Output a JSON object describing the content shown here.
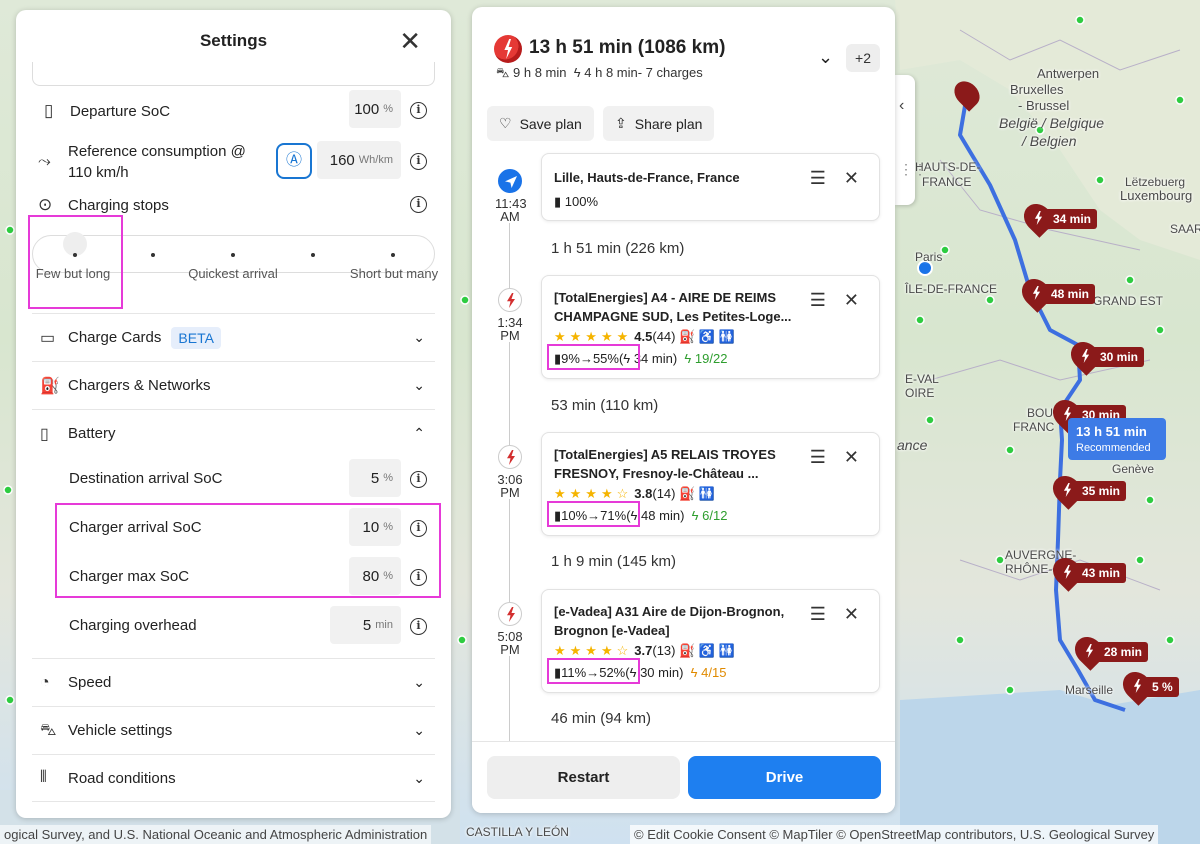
{
  "map": {
    "labels": {
      "antwerpen": "Antwerpen",
      "bruxelles": "Bruxelles",
      "brussel": "- Brussel",
      "belgie": "België / Belgique",
      "belgien": "/ Belgien",
      "letzebuerg": "Lëtzebuerg",
      "luxembourg": "Luxembourg",
      "hauts": "HAUTS-DE-",
      "france": "FRANCE",
      "paris": "Paris",
      "ile": "ÎLE-DE-FRANCE",
      "grand_est": "GRAND EST",
      "saarland": "SAARLA",
      "val": "E-VAL",
      "loire": "OIRE",
      "bour": "BOUR",
      "franc": "FRANC",
      "ance": "ance",
      "geneve": "Genève",
      "auvergne": "AUVERGNE-",
      "rhone": "RHÔNE-",
      "marseille": "Marseille",
      "castilla": "CASTILLA Y LEÓN"
    },
    "attribution_left": "ogical Survey, and U.S. National Oceanic and Atmospheric Administration",
    "attribution_right": "© Edit Cookie Consent  © MapTiler  © OpenStreetMap contributors, U.S. Geological Survey",
    "pins": [
      "34 min",
      "48 min",
      "30 min",
      "30 min",
      "35 min",
      "43 min",
      "28 min",
      "5 %"
    ],
    "route_label": {
      "time": "13 h 51 min",
      "tag": "Recommended"
    }
  },
  "settings": {
    "title": "Settings",
    "close": "✕",
    "departure_soc": {
      "label": "Departure SoC",
      "value": "100",
      "unit": "%"
    },
    "reference": {
      "label": "Reference consumption @ 110 km/h",
      "value": "160",
      "unit": "Wh/km"
    },
    "charging_stops": {
      "label": "Charging stops",
      "options": [
        "Few but long",
        "Quickest arrival",
        "Short but many"
      ]
    },
    "charge_cards": {
      "label": "Charge Cards",
      "badge": "BETA"
    },
    "chargers_networks": "Chargers & Networks",
    "battery": {
      "label": "Battery",
      "destination_soc": {
        "label": "Destination arrival SoC",
        "value": "5",
        "unit": "%"
      },
      "charger_arrival_soc": {
        "label": "Charger arrival SoC",
        "value": "10",
        "unit": "%"
      },
      "charger_max_soc": {
        "label": "Charger max SoC",
        "value": "80",
        "unit": "%"
      },
      "charging_overhead": {
        "label": "Charging overhead",
        "value": "5",
        "unit": "min"
      }
    },
    "speed": "Speed",
    "vehicle_settings": "Vehicle settings",
    "road_conditions": "Road conditions"
  },
  "route": {
    "title": "13 h 51 min (1086 km)",
    "drive_time": "9 h 8 min",
    "charge_time": "4 h 8 min- 7 charges",
    "more": "+2",
    "save_plan": "Save plan",
    "share_plan": "Share plan",
    "start": {
      "time": "11:43 AM",
      "name": "Lille, Hauts-de-France, France",
      "battery": "100%"
    },
    "legs": [
      "1 h 51 min (226 km)",
      "53 min (110 km)",
      "1 h 9 min (145 km)",
      "46 min (94 km)"
    ],
    "stops": [
      {
        "time": "1:34 PM",
        "name": "[TotalEnergies] A4 - AIRE DE REIMS CHAMPAGNE SUD, Les Petites-Loge...",
        "rating": "4.5",
        "reviews": "(44)",
        "soc": "9%→55%(",
        "duration": "34 min)",
        "availability": "19/22"
      },
      {
        "time": "3:06 PM",
        "name": "[TotalEnergies] A5 RELAIS TROYES FRESNOY, Fresnoy-le-Château ...",
        "rating": "3.8",
        "reviews": "(14)",
        "soc": "10%→71%(",
        "duration": "48 min)",
        "availability": "6/12"
      },
      {
        "time": "5:08 PM",
        "name": "[e-Vadea] A31 Aire de Dijon-Brognon, Brognon [e-Vadea]",
        "rating": "3.7",
        "reviews": "(13)",
        "soc": "11%→52%(",
        "duration": "30 min)",
        "availability": "4/15"
      }
    ],
    "restart": "Restart",
    "drive": "Drive"
  }
}
